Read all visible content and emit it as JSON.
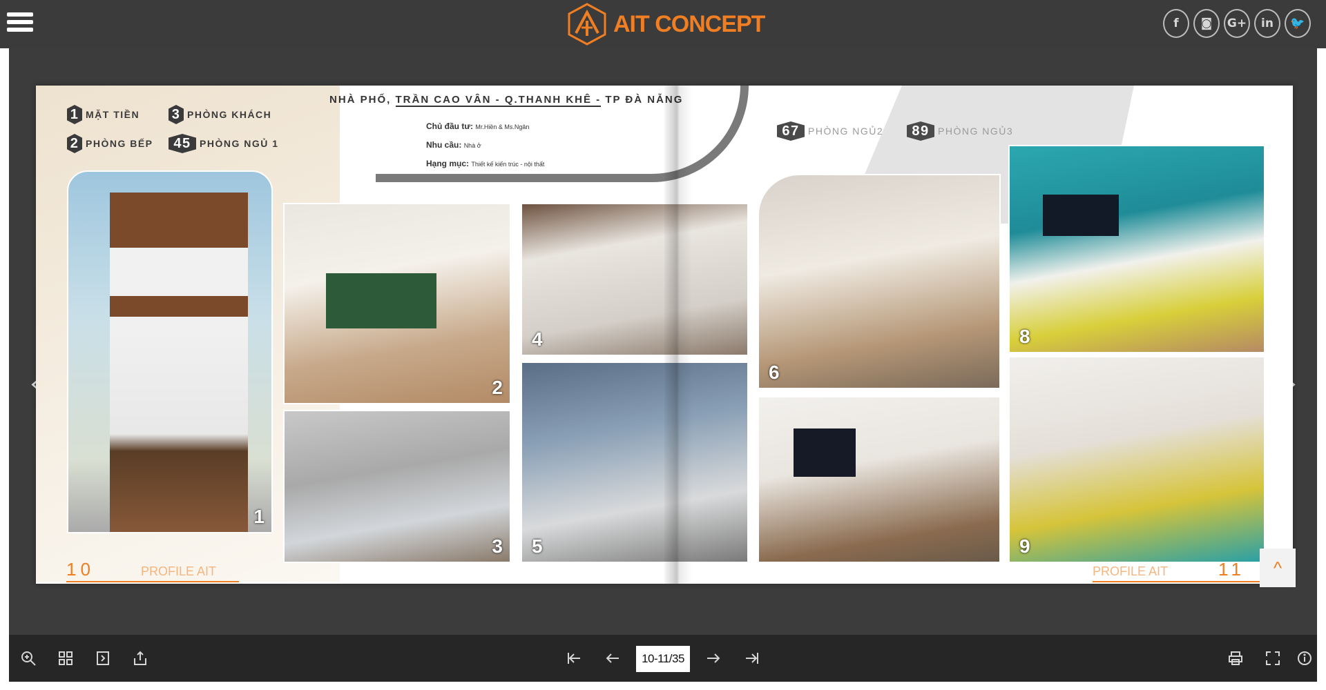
{
  "header": {
    "brand_name": "AIT CONCEPT",
    "brand_color": "#f07e23",
    "menu_icon": "hamburger-icon",
    "socials": [
      {
        "icon": "facebook-icon",
        "glyph": "f"
      },
      {
        "icon": "instagram-icon",
        "glyph": "◙"
      },
      {
        "icon": "google-plus-icon",
        "glyph": "G+"
      },
      {
        "icon": "linkedin-icon",
        "glyph": "in"
      },
      {
        "icon": "twitter-icon",
        "glyph": "🐦"
      }
    ]
  },
  "book": {
    "left_page": {
      "legend": [
        {
          "num": "1",
          "label": "MẶT TIỀN"
        },
        {
          "num": "3",
          "label": "PHÒNG KHÁCH"
        },
        {
          "num": "2",
          "label": "PHÒNG BẾP"
        },
        {
          "num": "45",
          "label": "PHÒNG NGỦ 1"
        }
      ],
      "title_prefix": "NHÀ PHỐ, ",
      "title_underlined": "TRẦN CAO VÂN - Q.THANH KHÊ -",
      "title_suffix": " TP ĐÀ NẴNG",
      "meta": [
        {
          "key": "Chủ đầu tư:",
          "value": "Mr.Hiền & Ms.Ngân"
        },
        {
          "key": "Nhu cầu:",
          "value": "Nhà ở"
        },
        {
          "key": "Hạng mục:",
          "value": "Thiết kế kiến trúc - nội thất"
        }
      ],
      "photo_labels": [
        "1",
        "2",
        "3",
        "4",
        "5"
      ],
      "page_number": "10",
      "footer_label": "PROFILE AIT"
    },
    "right_page": {
      "legend": [
        {
          "num": "67",
          "label": "PHÒNG NGỦ2"
        },
        {
          "num": "89",
          "label": "PHÒNG NGỦ3"
        }
      ],
      "photo_labels": [
        "6",
        "8",
        "9"
      ],
      "page_number": "11",
      "footer_label": "PROFILE AIT"
    }
  },
  "navigation": {
    "prev_icon": "chevron-left-icon",
    "next_icon": "chevron-right-icon",
    "back_to_top_icon": "chevron-up-icon"
  },
  "toolbar": {
    "left_icons": [
      "zoom-in-icon",
      "thumbnails-icon",
      "table-of-contents-icon",
      "share-icon"
    ],
    "nav_icons": [
      "first-page-icon",
      "previous-page-icon",
      "next-page-icon",
      "last-page-icon"
    ],
    "page_indicator": "10-11/35",
    "right_icons": [
      "print-icon",
      "fullscreen-icon",
      "info-icon"
    ]
  }
}
